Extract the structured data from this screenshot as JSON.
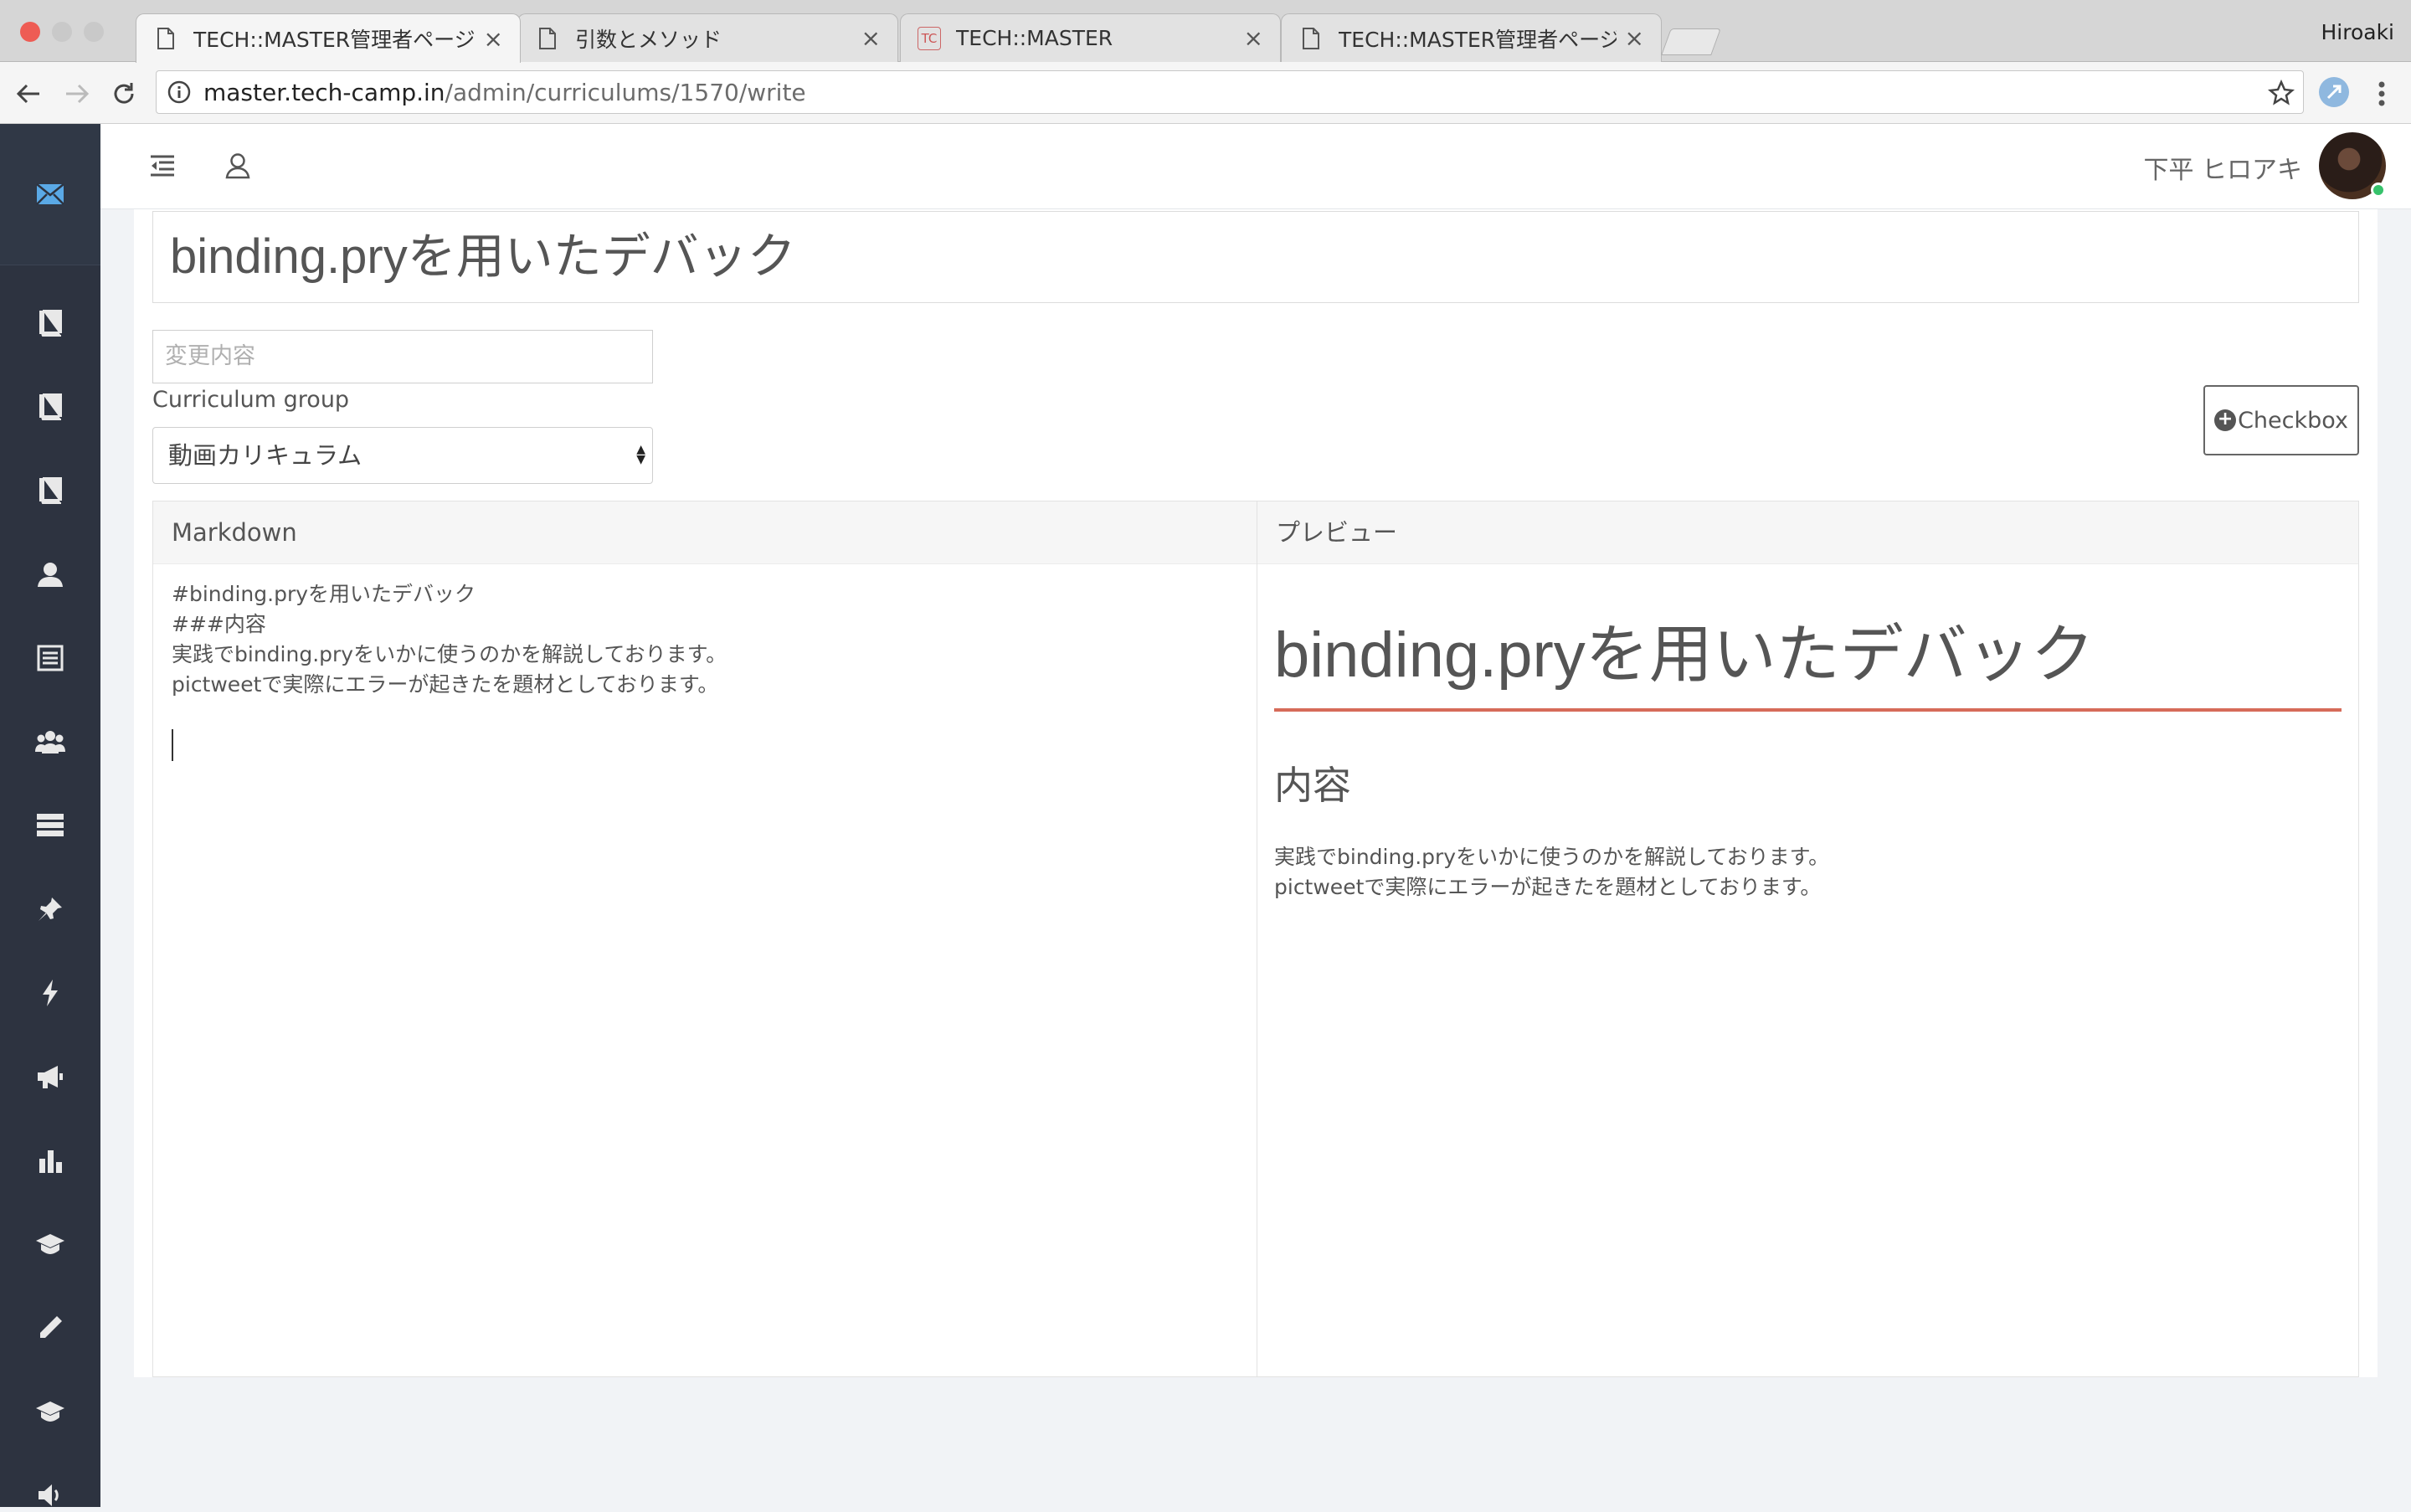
{
  "browser": {
    "tabs": [
      {
        "title": "TECH::MASTER管理者ページ",
        "active": true,
        "icon": "page-icon"
      },
      {
        "title": "引数とメソッド",
        "active": false,
        "icon": "page-icon"
      },
      {
        "title": "TECH::MASTER",
        "active": false,
        "icon": "tc-favicon",
        "favicon_text": "TC"
      },
      {
        "title": "TECH::MASTER管理者ページ",
        "active": false,
        "icon": "page-icon"
      }
    ],
    "close_glyph": "×",
    "profile_name": "Hiroaki",
    "url_host": "master.tech-camp.in",
    "url_path": "/admin/curriculums/1570/write"
  },
  "sidebar": {
    "icons": [
      "mail-icon",
      "book-icon",
      "book-icon",
      "book-icon",
      "user-icon",
      "list-icon",
      "users-icon",
      "server-icon",
      "pin-icon",
      "bolt-icon",
      "megaphone-icon",
      "bar-chart-icon",
      "graduation-cap-icon",
      "pencil-icon",
      "graduation-cap-icon",
      "volume-icon"
    ]
  },
  "header": {
    "username": "下平 ヒロアキ"
  },
  "form": {
    "title_value": "binding.pryを用いたデバック",
    "change_placeholder": "変更内容",
    "group_label": "Curriculum group",
    "group_selected": "動画カリキュラム",
    "checkbox_label": "Checkbox"
  },
  "editor": {
    "markdown_heading": "Markdown",
    "markdown_lines": [
      "#binding.pryを用いたデバック",
      "###内容",
      "実践でbinding.pryをいかに使うのかを解説しております。",
      "pictweetで実際にエラーが起きたを題材としております。"
    ],
    "preview_heading": "プレビュー",
    "preview_h1": "binding.pryを用いたデバック",
    "preview_h3": "内容",
    "preview_lines": [
      "実践でbinding.pryをいかに使うのかを解説しております。",
      "pictweetで実際にエラーが起きたを題材としております。"
    ]
  },
  "colors": {
    "sidebar_bg": "#2d3340",
    "accent_rule": "#d66b59",
    "online": "#36c26b",
    "mail_icon": "#5aa9e6"
  }
}
